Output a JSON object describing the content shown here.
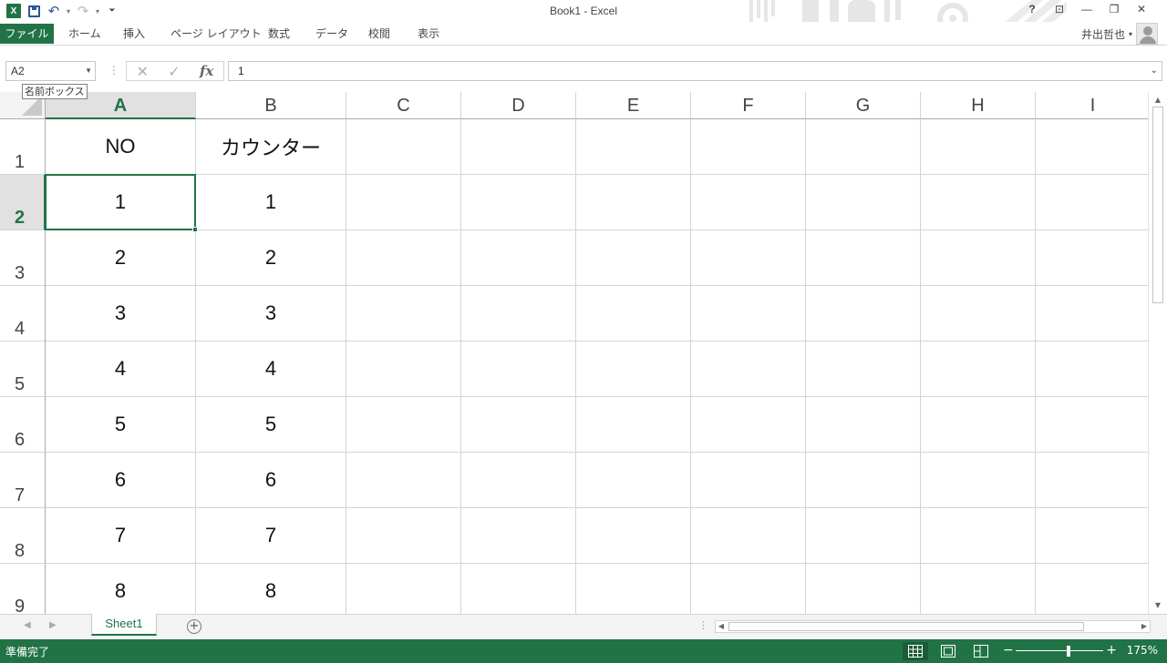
{
  "titlebar": {
    "title": "Book1 - Excel",
    "help": "?",
    "ribbon_display": "⊡",
    "minimize": "—",
    "restore": "❐",
    "close": "✕"
  },
  "ribbon": {
    "tabs": [
      "ファイル",
      "ホーム",
      "挿入",
      "ページ レイアウト",
      "数式",
      "データ",
      "校閲",
      "表示"
    ],
    "user_name": "井出哲也"
  },
  "formula_bar": {
    "name_box": "A2",
    "name_box_tooltip": "名前ボックス",
    "cancel_icon": "✕",
    "enter_icon": "✓",
    "fx_label": "fx",
    "value": "1"
  },
  "grid": {
    "columns": [
      "A",
      "B",
      "C",
      "D",
      "E",
      "F",
      "G",
      "H",
      "I"
    ],
    "rows": [
      "1",
      "2",
      "3",
      "4",
      "5",
      "6",
      "7",
      "8",
      "9"
    ],
    "cells": [
      [
        "NO",
        "カウンター"
      ],
      [
        "1",
        "1"
      ],
      [
        "2",
        "2"
      ],
      [
        "3",
        "3"
      ],
      [
        "4",
        "4"
      ],
      [
        "5",
        "5"
      ],
      [
        "6",
        "6"
      ],
      [
        "7",
        "7"
      ],
      [
        "8",
        "8"
      ]
    ],
    "active_cell": "A2"
  },
  "sheets": {
    "tabs": [
      "Sheet1"
    ],
    "add_sheet": "+"
  },
  "statusbar": {
    "status": "準備完了",
    "zoom_minus": "−",
    "zoom_plus": "+",
    "zoom_level": "175%"
  },
  "colors": {
    "accent": "#217346",
    "header_selected": "#e1e1e1",
    "gridline": "#d4d4d4"
  },
  "icons": {
    "app": "excel-logo-icon",
    "save": "save-icon",
    "undo": "undo-icon",
    "redo": "redo-icon",
    "customize": "customize-qat-icon",
    "avatar": "user-avatar-icon"
  }
}
